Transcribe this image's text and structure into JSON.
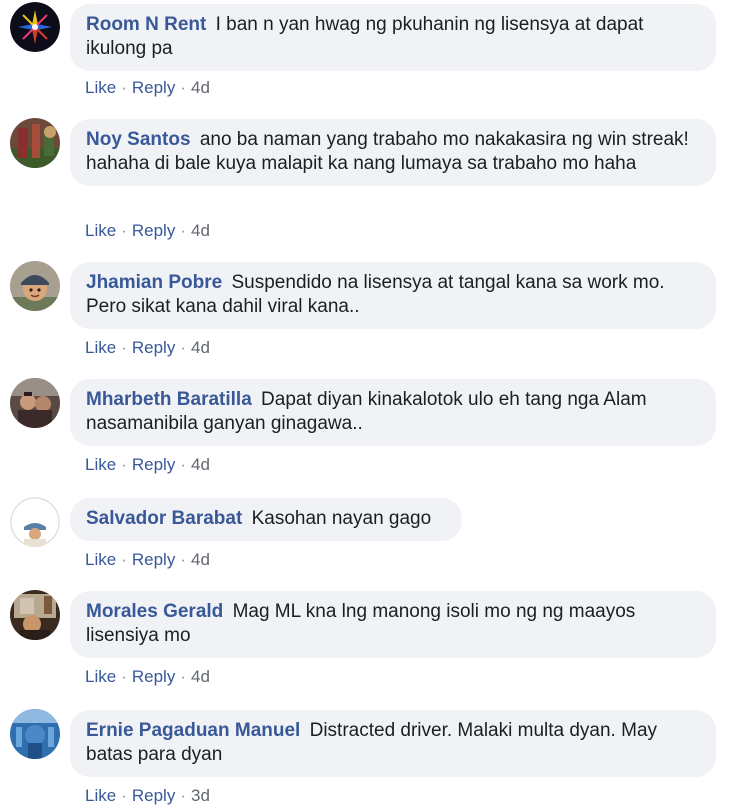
{
  "comments": [
    {
      "author": "Room N Rent",
      "text": "I ban n yan hwag ng pkuhanin ng lisensya at dapat ikulong pa",
      "like_label": "Like",
      "reply_label": "Reply",
      "separator": "·",
      "time": "4d",
      "avatar_icon": "star-compass-logo"
    },
    {
      "author": "Noy Santos",
      "text": "ano ba naman yang trabaho mo nakakasira ng win streak! hahaha di bale kuya malapit ka nang lumaya sa trabaho mo haha",
      "like_label": "Like",
      "reply_label": "Reply",
      "separator": "·",
      "time": "4d",
      "avatar_icon": "user-photo-avatar"
    },
    {
      "author": "Jhamian Pobre",
      "text": "Suspendido na lisensya at tangal kana sa work mo. Pero sikat kana dahil viral kana..",
      "like_label": "Like",
      "reply_label": "Reply",
      "separator": "·",
      "time": "4d",
      "avatar_icon": "user-photo-avatar"
    },
    {
      "author": "Mharbeth Baratilla",
      "text": "Dapat diyan kinakalotok ulo eh tang nga Alam nasamanibila ganyan ginagawa..",
      "like_label": "Like",
      "reply_label": "Reply",
      "separator": "·",
      "time": "4d",
      "avatar_icon": "user-photo-avatar"
    },
    {
      "author": "Salvador Barabat",
      "text": "Kasohan nayan gago",
      "like_label": "Like",
      "reply_label": "Reply",
      "separator": "·",
      "time": "4d",
      "avatar_icon": "user-photo-avatar"
    },
    {
      "author": "Morales Gerald",
      "text": "Mag ML kna lng manong isoli mo ng ng maayos lisensiya mo",
      "like_label": "Like",
      "reply_label": "Reply",
      "separator": "·",
      "time": "4d",
      "avatar_icon": "user-photo-avatar"
    },
    {
      "author": "Ernie Pagaduan Manuel",
      "text": "Distracted driver. Malaki multa dyan. May batas para dyan",
      "like_label": "Like",
      "reply_label": "Reply",
      "separator": "·",
      "time": "3d",
      "avatar_icon": "user-photo-avatar"
    }
  ],
  "colors": {
    "author": "#385898",
    "bubble_bg": "#f0f2f5",
    "meta": "#616770"
  }
}
